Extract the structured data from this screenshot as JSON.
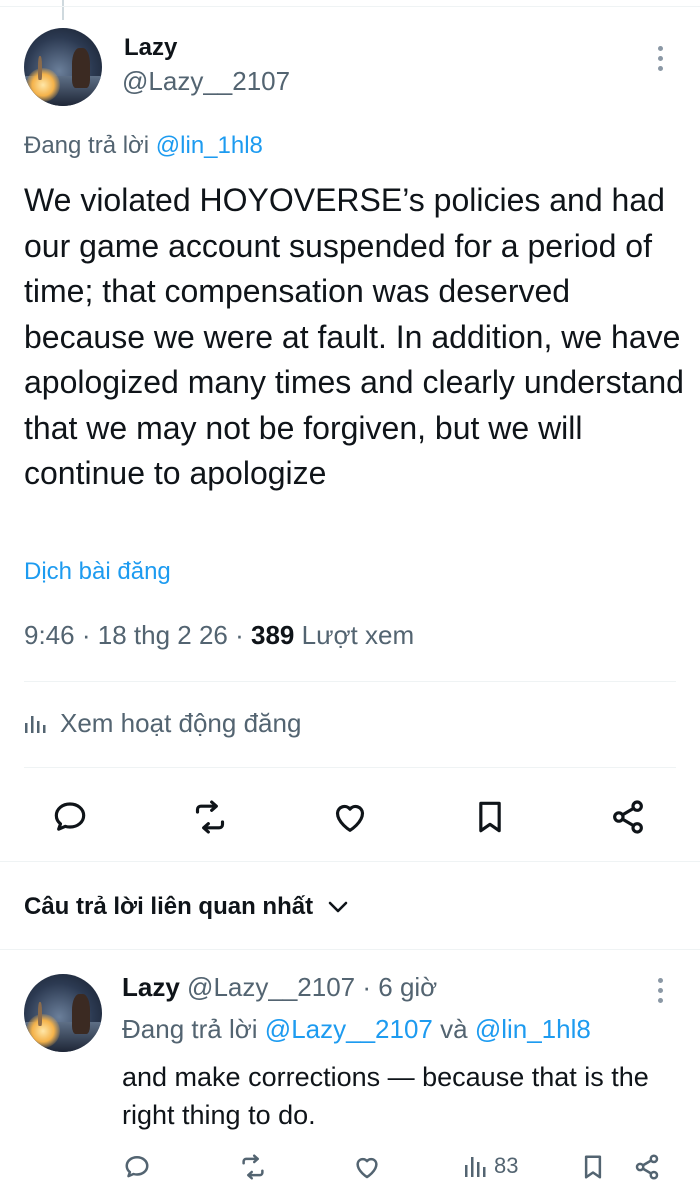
{
  "post": {
    "author_name": "Lazy",
    "author_handle": "@Lazy__2107",
    "replying_prefix": "Đang trả lời",
    "replying_to": "@lin_1hl8",
    "text": "We violated HOYOVERSE’s policies and had our game account suspended for a period of time; that compensation was deserved because we were at fault. In addition, we have apologized many times and clearly understand that we may not be forgiven, but we will continue to apologize",
    "translate_label": "Dịch bài đăng",
    "time": "9:46",
    "date": "18 thg 2 26",
    "views_count": "389",
    "views_label": "Lượt xem",
    "separator": "·",
    "activity_label": "Xem hoạt động đăng",
    "icons": {
      "more": "more-vertical-icon",
      "activity": "bar-chart-icon",
      "reply": "comment-icon",
      "retweet": "repost-icon",
      "like": "heart-icon",
      "bookmark": "bookmark-icon",
      "share": "share-icon"
    }
  },
  "replies_section": {
    "title": "Câu trả lời liên quan nhất",
    "dropdown_icon": "chevron-down-icon"
  },
  "reply": {
    "author_name": "Lazy",
    "author_handle": "@Lazy__2107",
    "meta_sep": "·",
    "time_ago": "6 giờ",
    "replying_prefix": "Đang trả lời",
    "replying_to_1": "@Lazy__2107",
    "conjunction": "và",
    "replying_to_2": "@lin_1hl8",
    "text": "and make corrections — because that is the right thing to do.",
    "views": "83"
  },
  "colors": {
    "accent": "#1d9bf0",
    "text_primary": "#0f1419",
    "text_secondary": "#536471",
    "divider": "#eff3f4"
  }
}
